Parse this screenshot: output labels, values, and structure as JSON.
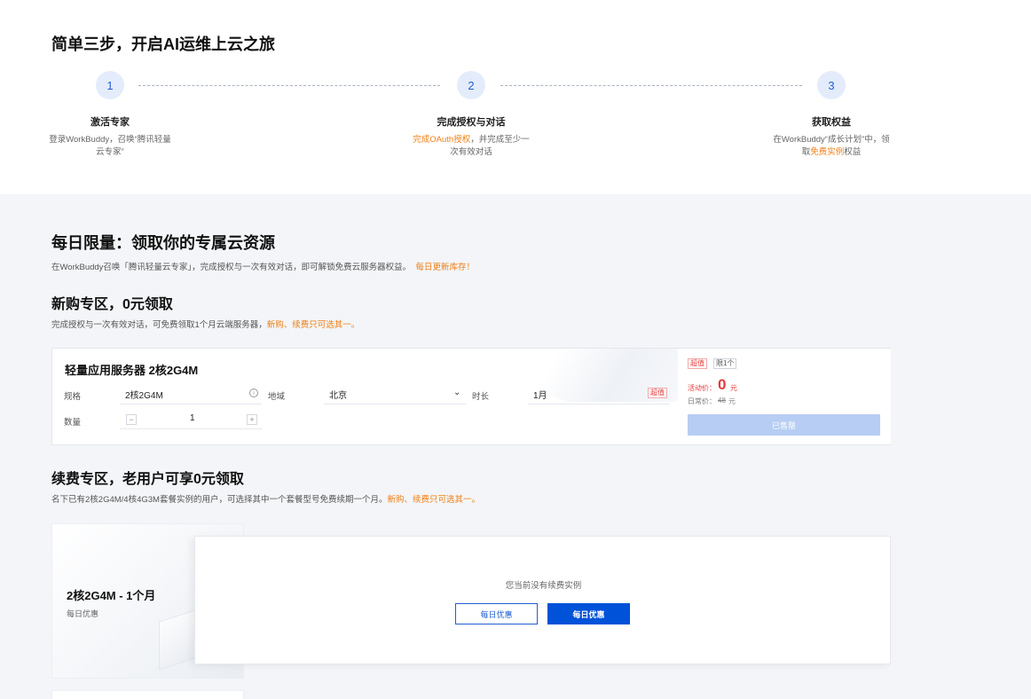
{
  "steps": {
    "title": "简单三步，开启AI运维上云之旅",
    "items": [
      {
        "num": "1",
        "name": "激活专家",
        "desc_a": "登录WorkBuddy，召唤“腾讯轻量云专家”",
        "desc_hl": "",
        "desc_b": ""
      },
      {
        "num": "2",
        "name": "完成授权与对话",
        "desc_a": "",
        "desc_hl": "完成OAuth授权",
        "desc_b": "，并完成至少一次有效对话"
      },
      {
        "num": "3",
        "name": "获取权益",
        "desc_a": "在WorkBuddy“成长计划”中，领取",
        "desc_hl": "免费实例",
        "desc_b": "权益"
      }
    ]
  },
  "daily": {
    "title": "每日限量：领取你的专属云资源",
    "subtitle": "在WorkBuddy召唤「腾讯轻量云专家」，完成授权与一次有效对话，即可解锁免费云服务器权益。",
    "subtitle_hl": "每日更新库存！"
  },
  "new_zone": {
    "title": "新购专区，0元领取",
    "subtitle": "完成授权与一次有效对话，可免费领取1个月云端服务器，",
    "subtitle_hl": "新购、续费只可选其一。"
  },
  "product": {
    "name": "轻量应用服务器 2核2G4M",
    "spec_label": "规格",
    "spec_value": "2核2G4M",
    "region_label": "地域",
    "region_value": "北京",
    "duration_label": "时长",
    "duration_value": "1月",
    "duration_tag": "超值",
    "qty_label": "数量",
    "qty_value": "1",
    "qty_minus": "−",
    "qty_plus": "+",
    "tag_deal": "超值",
    "tag_limit": "限1个",
    "promo_label": "活动价：",
    "promo_price": "0",
    "promo_unit": "元",
    "orig_label": "日常价：",
    "orig_price": "48",
    "orig_unit": "元",
    "soldout_label": "已售罄"
  },
  "renew_zone": {
    "title": "续费专区，老用户可享0元领取",
    "subtitle": "名下已有2核2G4M/4核4G3M套餐实例的用户，可选择其中一个套餐型号免费续期一个月。",
    "subtitle_hl": "新购、续费只可选其一。",
    "card_name": "2核2G4M - 1个月",
    "card_tag": "每日优惠",
    "empty_text": "您当前没有续费实例",
    "btn_outline": "每日优惠",
    "btn_primary": "每日优惠"
  },
  "colors": {
    "accent": "#0052d9",
    "highlight": "#f07f14",
    "price": "#e5393b"
  }
}
